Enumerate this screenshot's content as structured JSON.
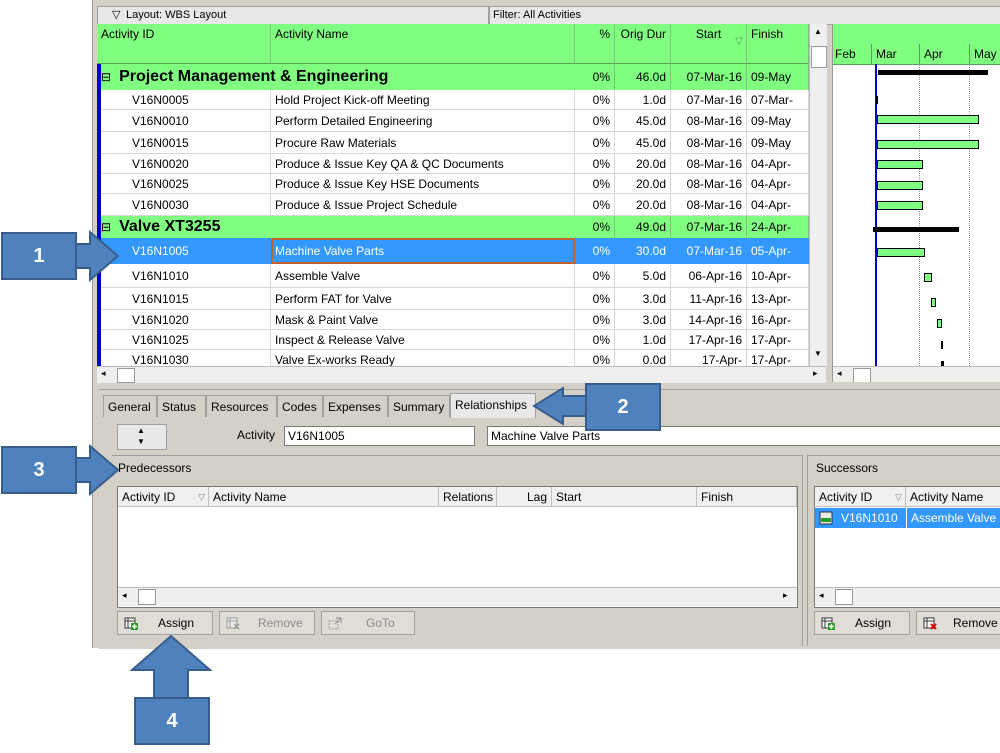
{
  "toolbar": {
    "layout_label": "Layout: WBS Layout",
    "filter_label": "Filter: All Activities"
  },
  "grid": {
    "columns": {
      "activity_id": "Activity ID",
      "activity_name": "Activity Name",
      "pct": "%",
      "orig_dur": "Orig Dur",
      "start": "Start",
      "finish": "Finish"
    },
    "rows": [
      {
        "type": "wbs",
        "id": "Project Management & Engineering",
        "pct": "0%",
        "dur": "46.0d",
        "start": "07-Mar-16",
        "finish": "09-May"
      },
      {
        "type": "act",
        "id": "V16N0005",
        "name": "Hold Project Kick-off Meeting",
        "pct": "0%",
        "dur": "1.0d",
        "start": "07-Mar-16",
        "finish": "07-Mar-"
      },
      {
        "type": "act",
        "id": "V16N0010",
        "name": "Perform Detailed Engineering",
        "pct": "0%",
        "dur": "45.0d",
        "start": "08-Mar-16",
        "finish": "09-May"
      },
      {
        "type": "act",
        "id": "V16N0015",
        "name": "Procure Raw Materials",
        "pct": "0%",
        "dur": "45.0d",
        "start": "08-Mar-16",
        "finish": "09-May"
      },
      {
        "type": "act",
        "id": "V16N0020",
        "name": "Produce & Issue Key QA & QC Documents",
        "pct": "0%",
        "dur": "20.0d",
        "start": "08-Mar-16",
        "finish": "04-Apr-"
      },
      {
        "type": "act",
        "id": "V16N0025",
        "name": "Produce & Issue Key HSE Documents",
        "pct": "0%",
        "dur": "20.0d",
        "start": "08-Mar-16",
        "finish": "04-Apr-"
      },
      {
        "type": "act",
        "id": "V16N0030",
        "name": "Produce & Issue Project Schedule",
        "pct": "0%",
        "dur": "20.0d",
        "start": "08-Mar-16",
        "finish": "04-Apr-"
      },
      {
        "type": "wbs",
        "id": "Valve XT3255",
        "pct": "0%",
        "dur": "49.0d",
        "start": "07-Mar-16",
        "finish": "24-Apr-"
      },
      {
        "type": "sel",
        "id": "V16N1005",
        "name": "Machine Valve Parts",
        "pct": "0%",
        "dur": "30.0d",
        "start": "07-Mar-16",
        "finish": "05-Apr-"
      },
      {
        "type": "act",
        "id": "V16N1010",
        "name": "Assemble Valve",
        "pct": "0%",
        "dur": "5.0d",
        "start": "06-Apr-16",
        "finish": "10-Apr-"
      },
      {
        "type": "act",
        "id": "V16N1015",
        "name": "Perform FAT for Valve",
        "pct": "0%",
        "dur": "3.0d",
        "start": "11-Apr-16",
        "finish": "13-Apr-"
      },
      {
        "type": "act",
        "id": "V16N1020",
        "name": "Mask & Paint Valve",
        "pct": "0%",
        "dur": "3.0d",
        "start": "14-Apr-16",
        "finish": "16-Apr-"
      },
      {
        "type": "act",
        "id": "V16N1025",
        "name": "Inspect & Release Valve",
        "pct": "0%",
        "dur": "1.0d",
        "start": "17-Apr-16",
        "finish": "17-Apr-"
      },
      {
        "type": "act",
        "id": "V16N1030",
        "name": "Valve Ex-works Ready",
        "pct": "0%",
        "dur": "0.0d",
        "start": "17-Apr-",
        "finish": "17-Apr-"
      }
    ]
  },
  "gantt": {
    "months": [
      "Feb",
      "Mar",
      "Apr",
      "May"
    ]
  },
  "tabs": [
    "General",
    "Status",
    "Resources",
    "Codes",
    "Expenses",
    "Summary",
    "Relationships"
  ],
  "detail": {
    "activity_label": "Activity",
    "activity_id": "V16N1005",
    "activity_name": "Machine Valve Parts"
  },
  "predecessors": {
    "title": "Predecessors",
    "columns": [
      "Activity ID",
      "Activity Name",
      "Relations",
      "Lag",
      "Start",
      "Finish"
    ],
    "buttons": {
      "assign": "Assign",
      "remove": "Remove",
      "goto": "GoTo"
    }
  },
  "successors": {
    "title": "Successors",
    "columns": [
      "Activity ID",
      "Activity Name"
    ],
    "rows": [
      {
        "id": "V16N1010",
        "name": "Assemble Valve"
      }
    ],
    "buttons": {
      "assign": "Assign",
      "remove": "Remove"
    }
  },
  "callouts": [
    "1",
    "2",
    "3",
    "4"
  ],
  "colors": {
    "wbs_band": "#80ff80",
    "selection": "#3399ff",
    "callout": "#4f81bd"
  }
}
